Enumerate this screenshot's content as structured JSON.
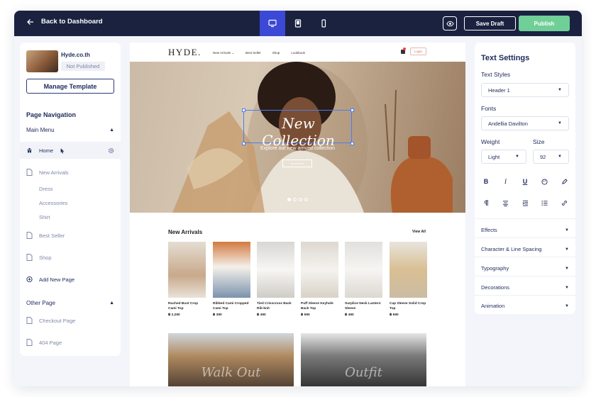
{
  "topbar": {
    "back_label": "Back to Dashboard",
    "save_draft": "Save Draft",
    "publish": "Publish",
    "active_device": "desktop",
    "accent": "#3b49d6",
    "publish_color": "#6fcf97"
  },
  "left": {
    "site_name": "Hyde.co.th",
    "status": "Not Published",
    "manage_template": "Manage Template",
    "page_navigation": "Page Navigation",
    "main_menu": "Main Menu",
    "home": "Home",
    "new_arrivals": "New Arrivals",
    "subitems": [
      "Dress",
      "Accessories",
      "Shirt"
    ],
    "best_seller": "Best Seller",
    "shop": "Shop",
    "add_new_page": "Add New Page",
    "other_page": "Other Page",
    "checkout_page": "Checkout Page",
    "page_404": "404 Page"
  },
  "site": {
    "logo": "HYDE.",
    "menu": [
      "New Arrivals ⌄",
      "Best Seller",
      "Shop",
      "Lookbook"
    ],
    "login": "Login",
    "hero_title": "New Collection",
    "hero_sub": "Explore our new arrived collection",
    "hero_button": "Shop Now",
    "section_title": "New Arrivals",
    "view_all": "View All",
    "products": [
      {
        "name": "Ruched Bust Crop Cami Top",
        "price": "฿ 2,290"
      },
      {
        "name": "Ribbed Cami Cropped Cami Top",
        "price": "฿ 390"
      },
      {
        "name": "Tied Crisscross Back Rib-knit",
        "price": "฿ 490"
      },
      {
        "name": "Puff Sleeve Keyhole Back Top",
        "price": "฿ 590"
      },
      {
        "name": "Surplice Neck Lantern Sleeve",
        "price": "฿ 490"
      },
      {
        "name": "Cap Sleeve Solid Crop Top",
        "price": "฿ 690"
      }
    ],
    "banners": [
      "Walk Out",
      "Outfit"
    ]
  },
  "right": {
    "title": "Text Settings",
    "text_styles_label": "Text Styles",
    "text_style_value": "Header 1",
    "fonts_label": "Fonts",
    "font_value": "Andellia Davilton",
    "weight_label": "Weight",
    "weight_value": "Light",
    "size_label": "Size",
    "size_value": "92",
    "format_buttons": [
      "B",
      "I",
      "U"
    ],
    "sections": [
      "Effects",
      "Character & Line Spacing",
      "Typography",
      "Decorations",
      "Animation"
    ]
  }
}
